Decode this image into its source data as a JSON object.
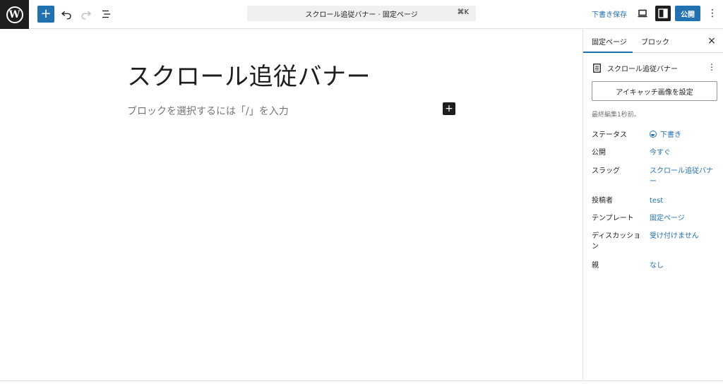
{
  "topbar": {
    "command_title": "スクロール追従バナー · 固定ページ",
    "command_shortcut": "⌘K",
    "save_draft": "下書き保存",
    "publish": "公開",
    "more": "⋮"
  },
  "editor": {
    "title": "スクロール追従バナー",
    "placeholder": "ブロックを選択するには「/」を入力"
  },
  "sidebar": {
    "tabs": {
      "page": "固定ページ",
      "block": "ブロック"
    },
    "close": "×",
    "doc_title": "スクロール追従バナー",
    "featured_image_button": "アイキャッチ画像を設定",
    "last_edited": "最終編集1秒前。",
    "meta": [
      {
        "label": "ステータス",
        "value": "下書き"
      },
      {
        "label": "公開",
        "value": "今すぐ"
      },
      {
        "label": "スラッグ",
        "value": "スクロール追従バナー"
      },
      {
        "label": "投稿者",
        "value": "test"
      },
      {
        "label": "テンプレート",
        "value": "固定ページ"
      },
      {
        "label": "ディスカッション",
        "value": "受け付けません"
      },
      {
        "label": "親",
        "value": "なし"
      }
    ]
  },
  "colors": {
    "accent": "#2271b1",
    "dark": "#1e1e1e",
    "muted": "#757575",
    "border": "#e0e0e0"
  }
}
